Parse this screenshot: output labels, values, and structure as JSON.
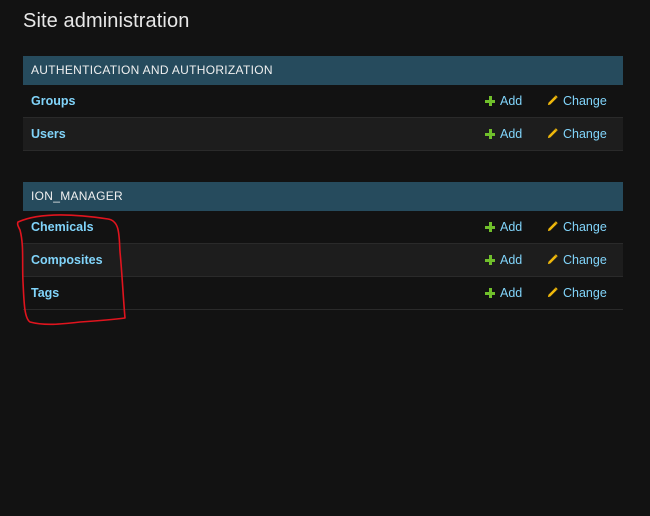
{
  "page": {
    "title": "Site administration"
  },
  "modules": [
    {
      "caption": "Authentication and Authorization",
      "models": [
        {
          "name": "Groups",
          "add_label": "Add",
          "change_label": "Change"
        },
        {
          "name": "Users",
          "add_label": "Add",
          "change_label": "Change"
        }
      ]
    },
    {
      "caption": "ION_MANAGER",
      "models": [
        {
          "name": "Chemicals",
          "add_label": "Add",
          "change_label": "Change"
        },
        {
          "name": "Composites",
          "add_label": "Add",
          "change_label": "Change"
        },
        {
          "name": "Tags",
          "add_label": "Add",
          "change_label": "Change"
        }
      ]
    }
  ],
  "icons": {
    "add": "plus-icon",
    "change": "pencil-icon"
  },
  "colors": {
    "background": "#121212",
    "caption_bg": "#264b5d",
    "link": "#81d4fa",
    "add_icon": "#70bf2b",
    "change_icon": "#efb80b",
    "annotation": "#e0141e"
  }
}
